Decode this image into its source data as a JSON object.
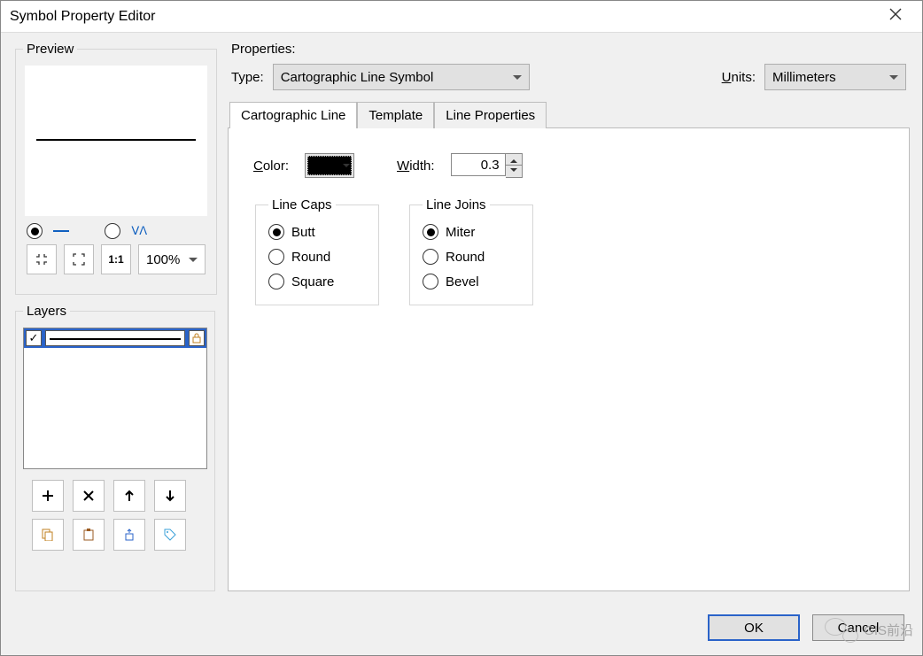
{
  "window": {
    "title": "Symbol Property Editor"
  },
  "preview": {
    "legend": "Preview",
    "zoom": "100%"
  },
  "layers": {
    "legend": "Layers"
  },
  "properties": {
    "heading": "Properties:",
    "type_label": "Type:",
    "type_value": "Cartographic Line Symbol",
    "units_label": "Units:",
    "units_value": "Millimeters",
    "tabs": {
      "cartographic": "Cartographic Line",
      "template": "Template",
      "line_props": "Line Properties"
    },
    "color_label": "Color:",
    "color_value": "#000000",
    "width_label": "Width:",
    "width_value": "0.3",
    "line_caps": {
      "legend": "Line Caps",
      "butt": "Butt",
      "round": "Round",
      "square": "Square",
      "selected": "butt"
    },
    "line_joins": {
      "legend": "Line Joins",
      "miter": "Miter",
      "round": "Round",
      "bevel": "Bevel",
      "selected": "miter"
    }
  },
  "footer": {
    "ok": "OK",
    "cancel": "Cancel"
  },
  "watermark": "GIS前沿"
}
